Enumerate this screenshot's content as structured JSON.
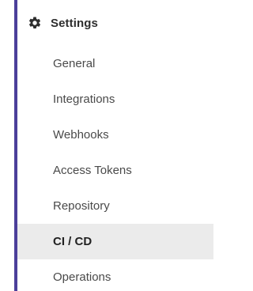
{
  "sidebar": {
    "header": {
      "icon": "gear-icon",
      "label": "Settings"
    },
    "items": [
      {
        "label": "General",
        "active": false
      },
      {
        "label": "Integrations",
        "active": false
      },
      {
        "label": "Webhooks",
        "active": false
      },
      {
        "label": "Access Tokens",
        "active": false
      },
      {
        "label": "Repository",
        "active": false
      },
      {
        "label": "CI / CD",
        "active": true
      },
      {
        "label": "Operations",
        "active": false
      }
    ],
    "colors": {
      "accent": "#4b3f9a",
      "active_background": "#ebebeb"
    }
  }
}
